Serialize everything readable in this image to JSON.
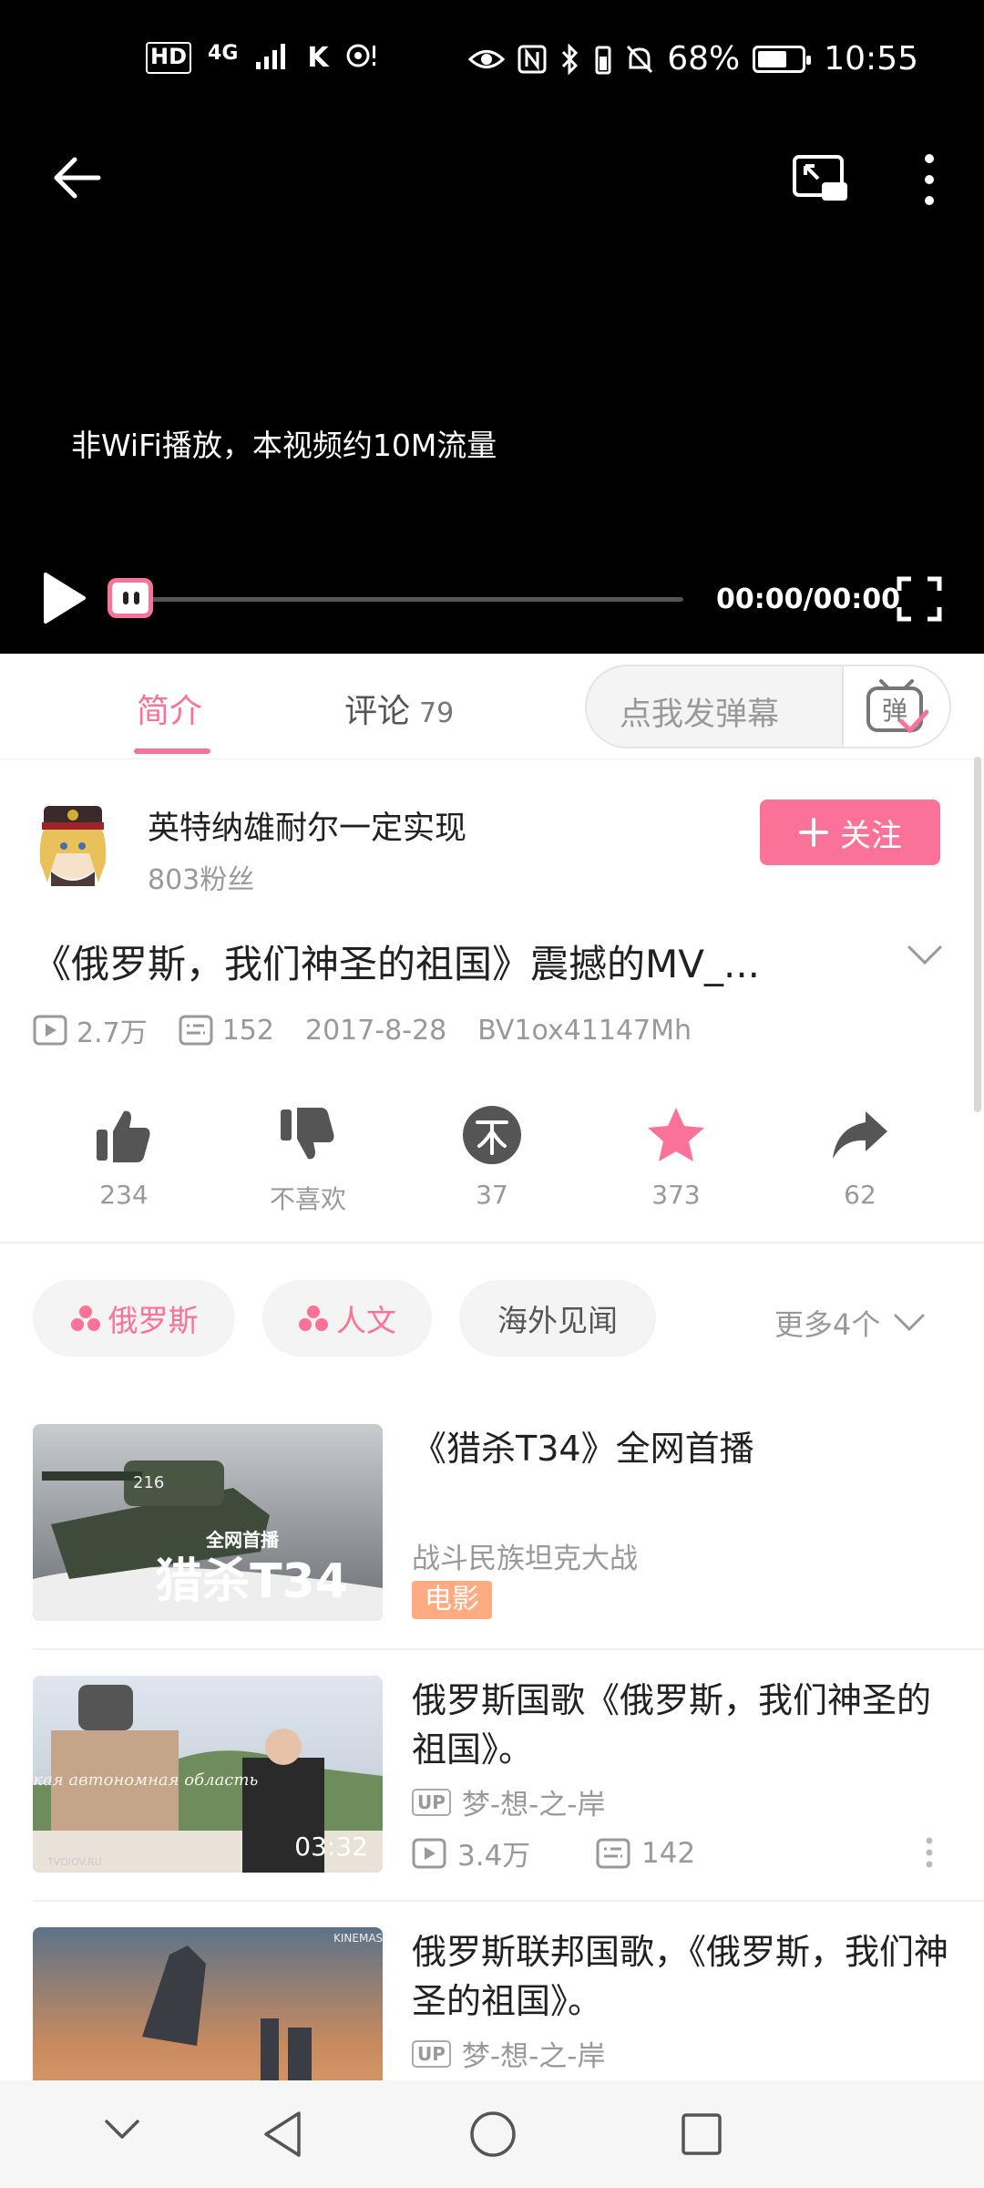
{
  "status_bar": {
    "left_indicators": [
      "HD",
      "4G",
      "K"
    ],
    "battery_percent": "68%",
    "battery_level": 0.68,
    "time": "10:55"
  },
  "player": {
    "wifi_notice": "非WiFi播放，本视频约10M流量",
    "time": "00:00/00:00",
    "progress": 0
  },
  "tabs": {
    "intro": "简介",
    "comments": "评论",
    "comments_count": "79",
    "danmaku_placeholder": "点我发弹幕",
    "danmaku_button": "弹"
  },
  "uploader": {
    "name": "英特纳雄耐尔一定实现",
    "fans": "803粉丝",
    "follow_label": "关注"
  },
  "video": {
    "title": "《俄罗斯，我们神圣的祖国》震撼的MV_...",
    "views": "2.7万",
    "danmaku": "152",
    "date": "2017-8-28",
    "bvid": "BV1ox41147Mh"
  },
  "actions": [
    {
      "name": "like",
      "label": "234"
    },
    {
      "name": "dislike",
      "label": "不喜欢"
    },
    {
      "name": "coin",
      "label": "37"
    },
    {
      "name": "favorite",
      "label": "373"
    },
    {
      "name": "share",
      "label": "62"
    }
  ],
  "tags": [
    {
      "label": "俄罗斯",
      "type": "pink"
    },
    {
      "label": "人文",
      "type": "pink"
    },
    {
      "label": "海外见闻",
      "type": "plain"
    }
  ],
  "more_tags": "更多4个",
  "recommendations": [
    {
      "title": "《猎杀T34》全网首播",
      "subtitle": "战斗民族坦克大战",
      "badge": "电影",
      "thumb_text_top": "全网首播",
      "thumb_text_main": "猎杀T34",
      "thumb_number": "216"
    },
    {
      "title": "俄罗斯国歌《俄罗斯，我们神圣的祖国》。",
      "up_badge": "UP",
      "author": "梦-想-之-岸",
      "duration": "03:32",
      "views": "3.4万",
      "danmaku": "142",
      "thumb_caption": "Еврейская автономная область",
      "thumb_watermark": "TVDIOV.RU"
    },
    {
      "title": "俄罗斯联邦国歌，《俄罗斯，我们神圣的祖国》。",
      "up_badge": "UP",
      "author": "梦-想-之-岸",
      "thumb_watermark": "KINEMASTER"
    }
  ],
  "colors": {
    "accent": "#fb7299",
    "movie_badge": "#ffab82"
  }
}
